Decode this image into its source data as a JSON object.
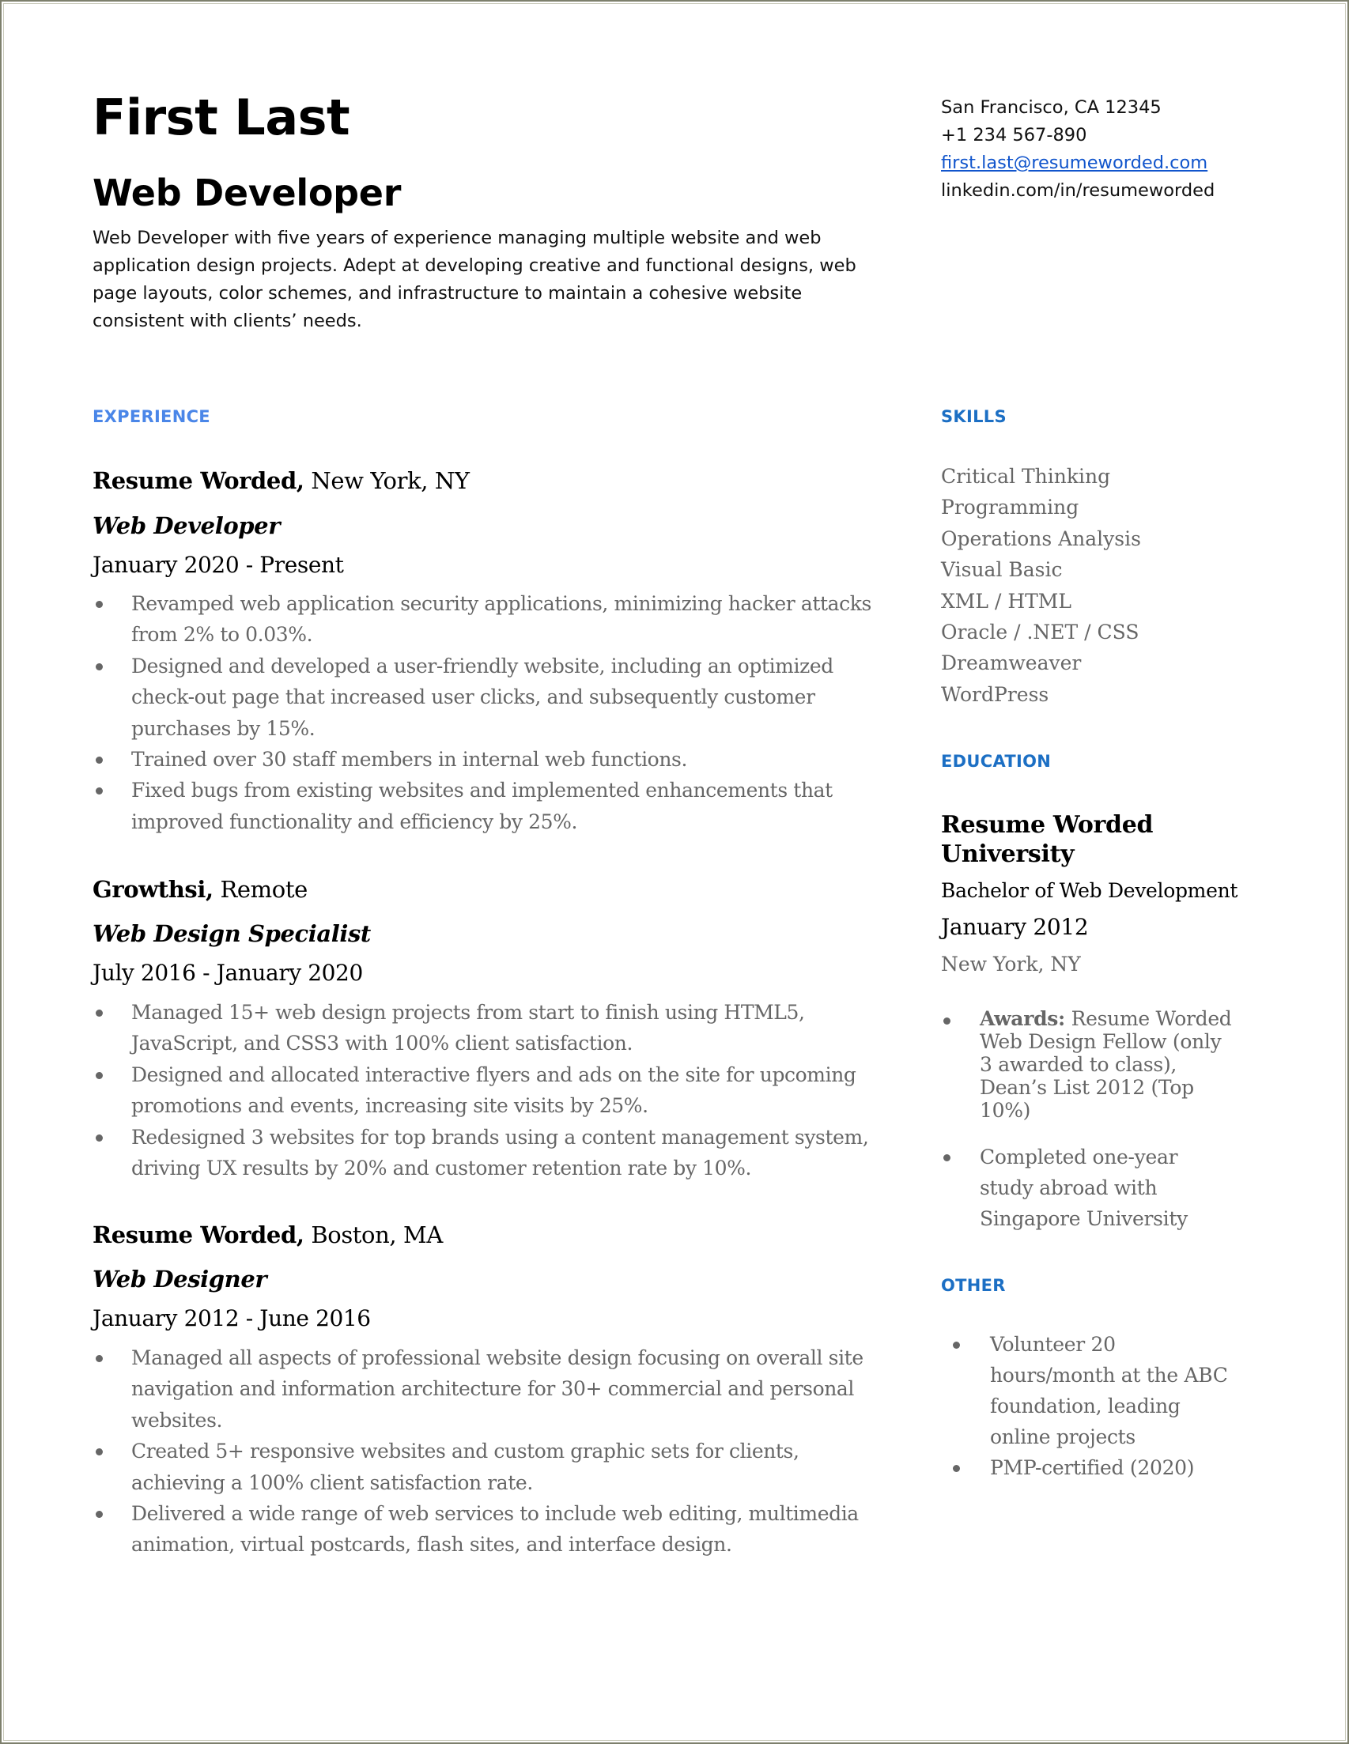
{
  "header": {
    "name": "First Last",
    "headline": "Web Developer",
    "summary_lines": [
      "Web Developer with five years of experience managing multiple website and web",
      "application design projects. Adept at developing creative and functional designs, web",
      "page layouts, color schemes, and infrastructure to maintain a cohesive website",
      "consistent with clients’ needs."
    ]
  },
  "contact": {
    "location": "San Francisco, CA 12345",
    "phone": "+1 234 567-890",
    "email": "first.last@resumeworded.com",
    "linkedin": "linkedin.com/in/resumeworded"
  },
  "colors": {
    "experience_heading": "#4a86e8",
    "sidebar_heading": "#1c6fc4",
    "link": "#1155cc",
    "body_gray": "#666666"
  },
  "experience": {
    "title": "EXPERIENCE",
    "jobs": [
      {
        "company": "Resume Worded,",
        "location": " New York, NY",
        "role": "Web Developer",
        "dates": "January 2020 - Present",
        "bullets": [
          [
            "Revamped web application security applications, minimizing hacker attacks",
            "from 2% to 0.03%."
          ],
          [
            "Designed and developed a user-friendly website, including an optimized",
            "check-out page that increased user clicks, and subsequently customer",
            "purchases by 15%."
          ],
          [
            "Trained over 30 staff members in internal web functions."
          ],
          [
            "Fixed bugs from existing websites and implemented enhancements that",
            "improved functionality and efficiency by 25%."
          ]
        ]
      },
      {
        "company": "Growthsi,",
        "location": " Remote",
        "role": "Web Design Specialist",
        "dates": "July 2016 - January 2020",
        "bullets": [
          [
            "Managed 15+ web design projects from start to finish using HTML5,",
            "JavaScript, and CSS3 with 100% client satisfaction."
          ],
          [
            "Designed and allocated interactive flyers and ads on the site for upcoming",
            "promotions and events, increasing site visits by 25%."
          ],
          [
            "Redesigned 3 websites for top brands using a content management system,",
            "driving UX results by 20% and customer retention rate by 10%."
          ]
        ]
      },
      {
        "company": "Resume Worded,",
        "location": " Boston, MA",
        "role": "Web Designer",
        "dates": "January 2012 - June 2016",
        "bullets": [
          [
            "Managed all aspects of professional website design focusing on overall site",
            "navigation and information architecture for 30+ commercial and personal",
            "websites."
          ],
          [
            "Created 5+ responsive websites and custom graphic sets for clients,",
            "achieving a 100% client satisfaction rate."
          ],
          [
            "Delivered a wide range of web services to include web editing, multimedia",
            "animation, virtual postcards, flash sites, and interface design."
          ]
        ]
      }
    ]
  },
  "skills": {
    "title": "SKILLS",
    "items": [
      "Critical Thinking",
      "Programming",
      "Operations Analysis",
      "Visual Basic",
      "XML / HTML",
      "Oracle / .NET / CSS",
      "Dreamweaver",
      "WordPress"
    ]
  },
  "education": {
    "title": "EDUCATION",
    "school": "Resume Worded University",
    "degree": "Bachelor of Web Development",
    "date": "January 2012",
    "location": "New York, NY",
    "awards_label": "Awards:",
    "awards_lines": [
      " Resume Worded",
      "Web Design Fellow (only",
      "3 awarded to class),",
      "Dean’s List 2012 (Top",
      "10%)"
    ],
    "study_abroad_lines": [
      "Completed one-year",
      "study abroad with",
      "Singapore University"
    ]
  },
  "other": {
    "title": "OTHER",
    "items": [
      [
        "Volunteer 20",
        "hours/month at the ABC",
        "foundation, leading",
        "online projects"
      ],
      [
        "PMP-certified (2020)"
      ]
    ]
  }
}
